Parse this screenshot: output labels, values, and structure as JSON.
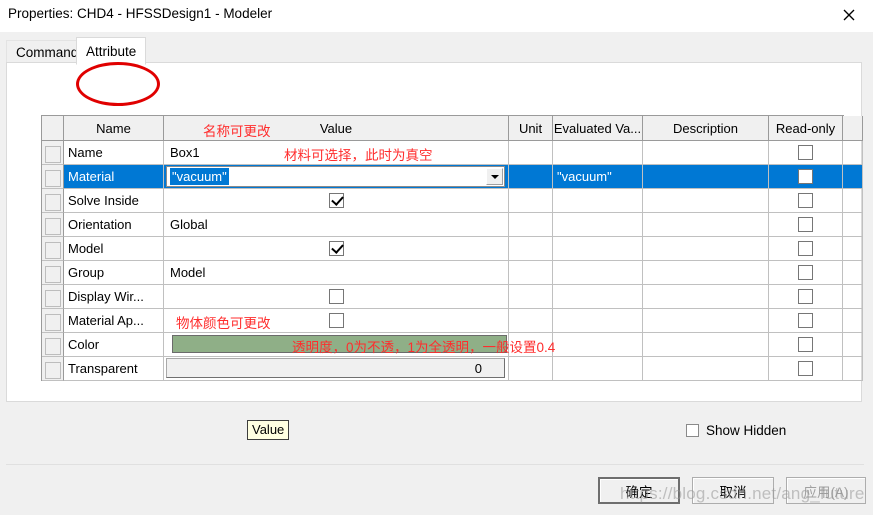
{
  "window": {
    "title": "Properties: CHD4 - HFSSDesign1 - Modeler",
    "close_icon": "close-icon"
  },
  "tabs": [
    {
      "label": "Command",
      "selected": false
    },
    {
      "label": "Attribute",
      "selected": true
    }
  ],
  "grid": {
    "columns": [
      "Name",
      "Value",
      "Unit",
      "Evaluated Va...",
      "Description",
      "Read-only"
    ],
    "rows": [
      {
        "name": "Name",
        "value": "Box1",
        "value_type": "text",
        "unit": "",
        "evaluated": "",
        "description": "",
        "readonly": false,
        "selected": false
      },
      {
        "name": "Material",
        "value": "\"vacuum\"",
        "value_type": "combo",
        "unit": "",
        "evaluated": "\"vacuum\"",
        "description": "",
        "readonly": false,
        "selected": true
      },
      {
        "name": "Solve Inside",
        "value": "",
        "value_type": "checkbox",
        "checked": true,
        "unit": "",
        "evaluated": "",
        "description": "",
        "readonly": false,
        "selected": false
      },
      {
        "name": "Orientation",
        "value": "Global",
        "value_type": "text",
        "unit": "",
        "evaluated": "",
        "description": "",
        "readonly": false,
        "selected": false
      },
      {
        "name": "Model",
        "value": "",
        "value_type": "checkbox",
        "checked": true,
        "unit": "",
        "evaluated": "",
        "description": "",
        "readonly": false,
        "selected": false
      },
      {
        "name": "Group",
        "value": "Model",
        "value_type": "text",
        "unit": "",
        "evaluated": "",
        "description": "",
        "readonly": false,
        "selected": false
      },
      {
        "name": "Display Wir...",
        "value": "",
        "value_type": "checkbox",
        "checked": false,
        "unit": "",
        "evaluated": "",
        "description": "",
        "readonly": false,
        "selected": false
      },
      {
        "name": "Material Ap...",
        "value": "",
        "value_type": "checkbox",
        "checked": false,
        "unit": "",
        "evaluated": "",
        "description": "",
        "readonly": false,
        "selected": false
      },
      {
        "name": "Color",
        "value": "",
        "value_type": "color",
        "swatch": "#8faf87",
        "unit": "",
        "evaluated": "",
        "description": "",
        "readonly": false,
        "selected": false
      },
      {
        "name": "Transparent",
        "value": "0",
        "value_type": "slider",
        "unit": "",
        "evaluated": "",
        "description": "",
        "readonly": false,
        "selected": false
      }
    ]
  },
  "annotations": [
    {
      "id": "annot_name",
      "text": "名称可更改"
    },
    {
      "id": "annot_material",
      "text": "材料可选择，此时为真空"
    },
    {
      "id": "annot_color",
      "text": "物体颜色可更改"
    },
    {
      "id": "annot_transparent",
      "text": "透明度，0为不透，1为全透明，一般设置0.4"
    }
  ],
  "tooltip": {
    "text": "Value"
  },
  "show_hidden": {
    "label": "Show Hidden",
    "checked": false
  },
  "buttons": {
    "ok": "确定",
    "cancel": "取消",
    "apply": "应用(A)"
  },
  "watermark": {
    "text": "https://blog.csdn.net/ang_future"
  },
  "colors": {
    "selection": "#0078d4",
    "annotation": "#ff2d2d",
    "swatch": "#8faf87",
    "dialog_bg": "#f0f0f0"
  }
}
